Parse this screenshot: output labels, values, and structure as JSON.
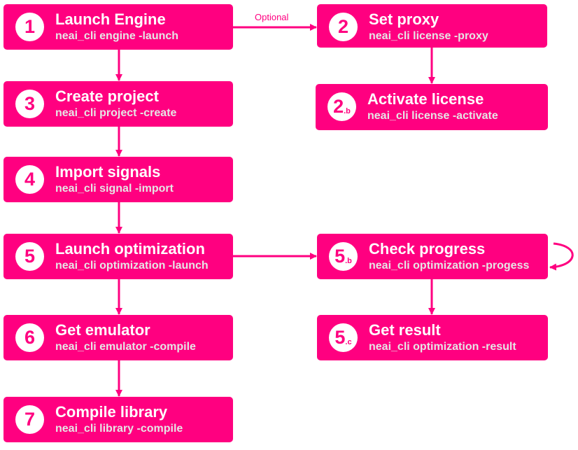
{
  "accent": "#ff0080",
  "edge_label": "Optional",
  "steps": [
    {
      "id": "1",
      "num": "1",
      "sub": "",
      "title": "Launch Engine",
      "cmd": "neai_cli engine -launch"
    },
    {
      "id": "2",
      "num": "2",
      "sub": "",
      "title": "Set proxy",
      "cmd": "neai_cli license -proxy"
    },
    {
      "id": "2b",
      "num": "2",
      "sub": ".b",
      "title": "Activate license",
      "cmd": "neai_cli license -activate"
    },
    {
      "id": "3",
      "num": "3",
      "sub": "",
      "title": "Create project",
      "cmd": "neai_cli project -create"
    },
    {
      "id": "4",
      "num": "4",
      "sub": "",
      "title": "Import signals",
      "cmd": "neai_cli signal -import"
    },
    {
      "id": "5",
      "num": "5",
      "sub": "",
      "title": "Launch optimization",
      "cmd": "neai_cli optimization -launch"
    },
    {
      "id": "5b",
      "num": "5",
      "sub": ".b",
      "title": "Check progress",
      "cmd": "neai_cli optimization -progess"
    },
    {
      "id": "5c",
      "num": "5",
      "sub": ".c",
      "title": "Get result",
      "cmd": "neai_cli optimization -result"
    },
    {
      "id": "6",
      "num": "6",
      "sub": "",
      "title": "Get emulator",
      "cmd": "neai_cli emulator -compile"
    },
    {
      "id": "7",
      "num": "7",
      "sub": "",
      "title": "Compile library",
      "cmd": "neai_cli library -compile"
    }
  ]
}
